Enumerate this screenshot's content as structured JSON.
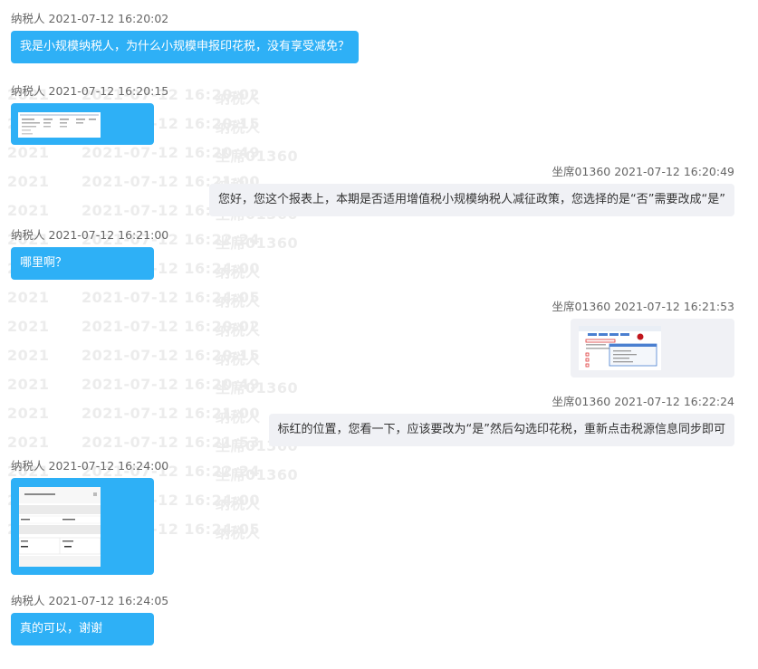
{
  "conversation": {
    "messages": [
      {
        "sender": "纳税人",
        "time": "2021-07-12 16:20:02",
        "text": "我是小规模纳税人，为什么小规模申报印花税，没有享受减免？"
      },
      {
        "sender": "纳税人",
        "time": "2021-07-12 16:20:15",
        "image": "thumbnail-table"
      },
      {
        "sender": "坐席01360",
        "time": "2021-07-12 16:20:49",
        "text": "您好，您这个报表上，本期是否适用增值税小规模纳税人减征政策，您选择的是“否”需要改成“是”"
      },
      {
        "sender": "纳税人",
        "time": "2021-07-12 16:21:00",
        "text": "哪里啊？"
      },
      {
        "sender": "坐席01360",
        "time": "2021-07-12 16:21:53",
        "image": "thumbnail-form"
      },
      {
        "sender": "坐席01360",
        "time": "2021-07-12 16:22:24",
        "text": "标红的位置，您看一下，应该要改为“是”然后勾选印花税，重新点击税源信息同步即可"
      },
      {
        "sender": "纳税人",
        "time": "2021-07-12 16:24:00",
        "image": "thumbnail-phone"
      },
      {
        "sender": "纳税人",
        "time": "2021-07-12 16:24:05",
        "text": "真的可以，谢谢"
      }
    ]
  },
  "colors": {
    "customer_bubble": "#2eb0f6",
    "agent_bubble": "#f0f1f5",
    "meta_text": "#666666",
    "watermark": "#ececec"
  }
}
